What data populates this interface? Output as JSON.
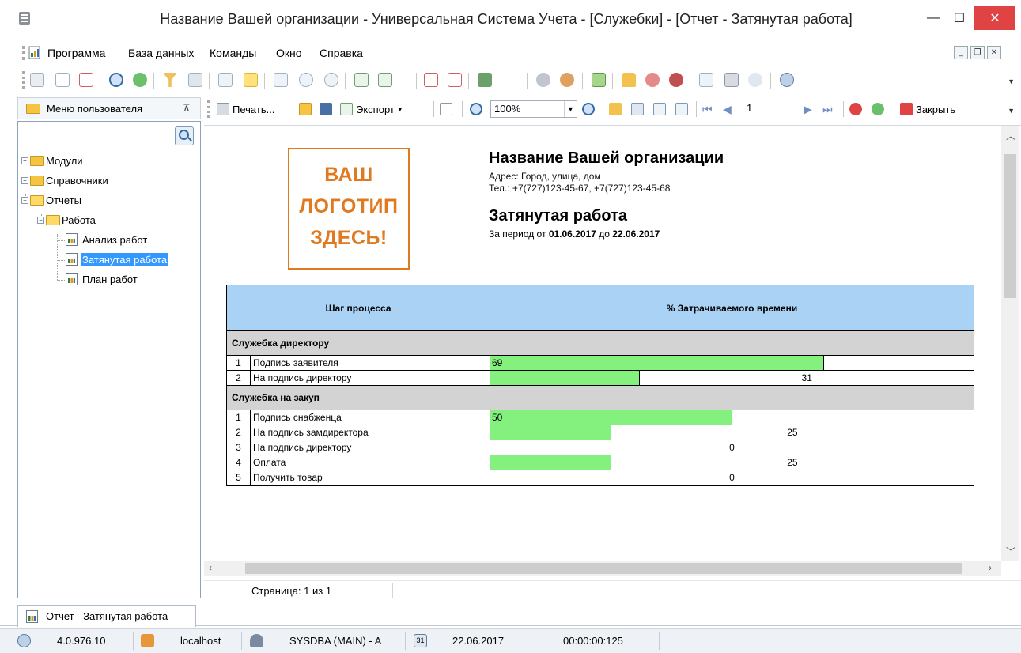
{
  "window": {
    "title": "Название Вашей организации - Универсальная Система Учета - [Служебки] - [Отчет - Затянутая работа]",
    "min_glyph": "—",
    "max_glyph": "☐",
    "close_glyph": "✕"
  },
  "menu": {
    "items": [
      "Программа",
      "База данных",
      "Команды",
      "Окно",
      "Справка"
    ]
  },
  "left_panel": {
    "title": "Меню пользователя",
    "tree": {
      "modules": "Модули",
      "directories": "Справочники",
      "reports": "Отчеты",
      "work": "Работа",
      "analysis": "Анализ работ",
      "delayed": "Затянутая работа",
      "plan": "План работ"
    }
  },
  "report_toolbar": {
    "print": "Печать...",
    "export": "Экспорт",
    "zoom": "100%",
    "page": "1",
    "close": "Закрыть"
  },
  "report": {
    "logo_lines": [
      "ВАШ",
      "ЛОГОТИП",
      "ЗДЕСЬ!"
    ],
    "org_name": "Название Вашей организации",
    "address": "Адрес: Город, улица, дом",
    "phone": "Тел.: +7(727)123-45-67, +7(727)123-45-68",
    "title": "Затянутая работа",
    "period_prefix": "За период от",
    "date_from": "01.06.2017",
    "period_mid": "до",
    "date_to": "22.06.2017",
    "col_step": "Шаг процесса",
    "col_percent": "% Затрачиваемого времени",
    "groups": [
      {
        "name": "Служебка директору",
        "rows": [
          {
            "n": "1",
            "step": "Подпись заявителя",
            "percent": 69,
            "label": "69"
          },
          {
            "n": "2",
            "step": "На подпись директору",
            "percent": 31,
            "label": "31"
          }
        ]
      },
      {
        "name": "Служебка на закуп",
        "rows": [
          {
            "n": "1",
            "step": "Подпись снабженца",
            "percent": 50,
            "label": "50"
          },
          {
            "n": "2",
            "step": "На подпись замдиректора",
            "percent": 25,
            "label": "25"
          },
          {
            "n": "3",
            "step": "На подпись директору",
            "percent": 0,
            "label": "0"
          },
          {
            "n": "4",
            "step": "Оплата",
            "percent": 25,
            "label": "25"
          },
          {
            "n": "5",
            "step": "Получить товар",
            "percent": 0,
            "label": "0"
          }
        ]
      }
    ],
    "bar_color": "#84f17f",
    "header_color": "#a9d2f5"
  },
  "page_status": "Страница: 1 из 1",
  "doc_tab": "Отчет - Затянутая работа",
  "statusbar": {
    "version": "4.0.976.10",
    "host": "localhost",
    "user": "SYSDBA (MAIN) - A",
    "calendar_day": "31",
    "date": "22.06.2017",
    "timer": "00:00:00:125"
  }
}
